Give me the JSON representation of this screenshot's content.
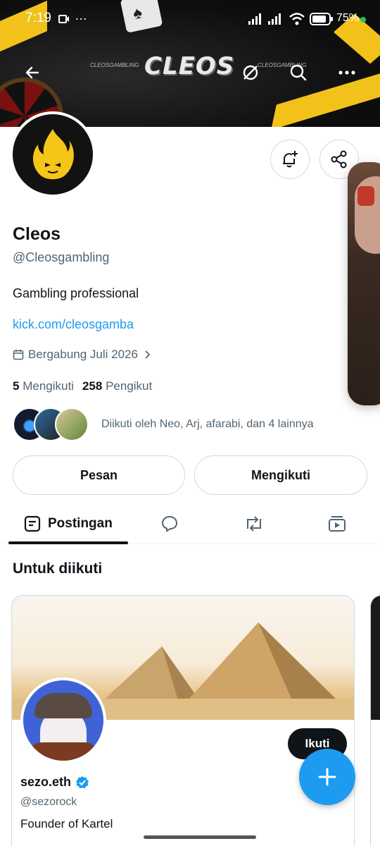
{
  "status_bar": {
    "time": "7:19",
    "battery": "75%"
  },
  "banner": {
    "logo_text": "CLEOS",
    "handle_left": "CLEOSGAMBLING",
    "handle_right": "CLEOSGAMBLING"
  },
  "profile": {
    "name": "Cleos",
    "handle": "@Cleosgambling",
    "bio": "Gambling professional",
    "link": "kick.com/cleosgamba",
    "joined": "Bergabung Juli 2026",
    "following_count": "5",
    "following_label": "Mengikuti",
    "followers_count": "258",
    "followers_label": "Pengikut",
    "followed_by": "Diikuti oleh Neo, Arj, afarabi, dan 4 lainnya"
  },
  "actions": {
    "message": "Pesan",
    "following": "Mengikuti"
  },
  "tabs": [
    {
      "label": "Postingan"
    }
  ],
  "suggestions": {
    "title": "Untuk diikuti",
    "items": [
      {
        "name": "sezo.eth",
        "handle": "@sezorock",
        "bio": "Founder of Kartel",
        "follow_label": "Ikuti",
        "verified": true
      }
    ]
  },
  "colors": {
    "accent": "#1d9bf0",
    "text": "#0f1419",
    "muted": "#536471",
    "banner_yellow": "#f2c21b"
  }
}
